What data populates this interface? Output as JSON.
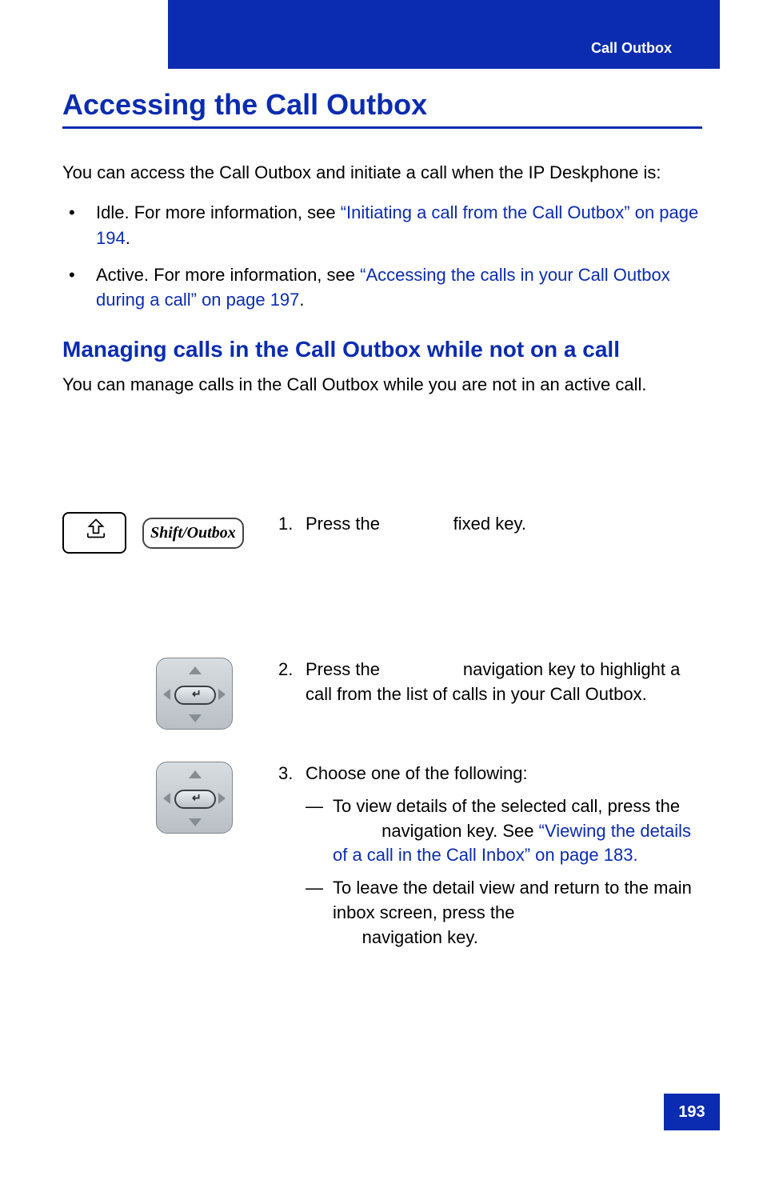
{
  "header": {
    "section_label": "Call Outbox"
  },
  "h1": "Accessing the Call Outbox",
  "intro": "You can access the Call Outbox and initiate a call when the IP Deskphone is:",
  "bullets": [
    {
      "pre": "Idle. For more information, see ",
      "link": "“Initiating a call from the Call Outbox” on page 194",
      "post": "."
    },
    {
      "pre": "Active. For more information, see ",
      "link": "“Accessing the calls in your Call Outbox during a call” on page 197",
      "post": "."
    }
  ],
  "h2": "Managing calls in the Call Outbox while not on a call",
  "h2_body": "You can manage calls in the Call Outbox while you are not in an active call.",
  "shift_outbox_key_label": "Shift/Outbox",
  "steps": {
    "s1": {
      "num": "1.",
      "a": "Press the ",
      "b": " fixed key."
    },
    "s2": {
      "num": "2.",
      "a": "Press the ",
      "b": " navigation key to highlight a call from the list of calls in your Call Outbox."
    },
    "s3": {
      "num": "3.",
      "lead": "Choose one of the following:",
      "sub1": {
        "a": "To view details of the selected call, press the ",
        "b": " navigation key. See ",
        "link": "“Viewing the details of a call in the Call Inbox” on page 183."
      },
      "sub2": {
        "a": "To leave the detail view and return to the main inbox screen, press the ",
        "b": " navigation key."
      }
    }
  },
  "page_number": "193"
}
